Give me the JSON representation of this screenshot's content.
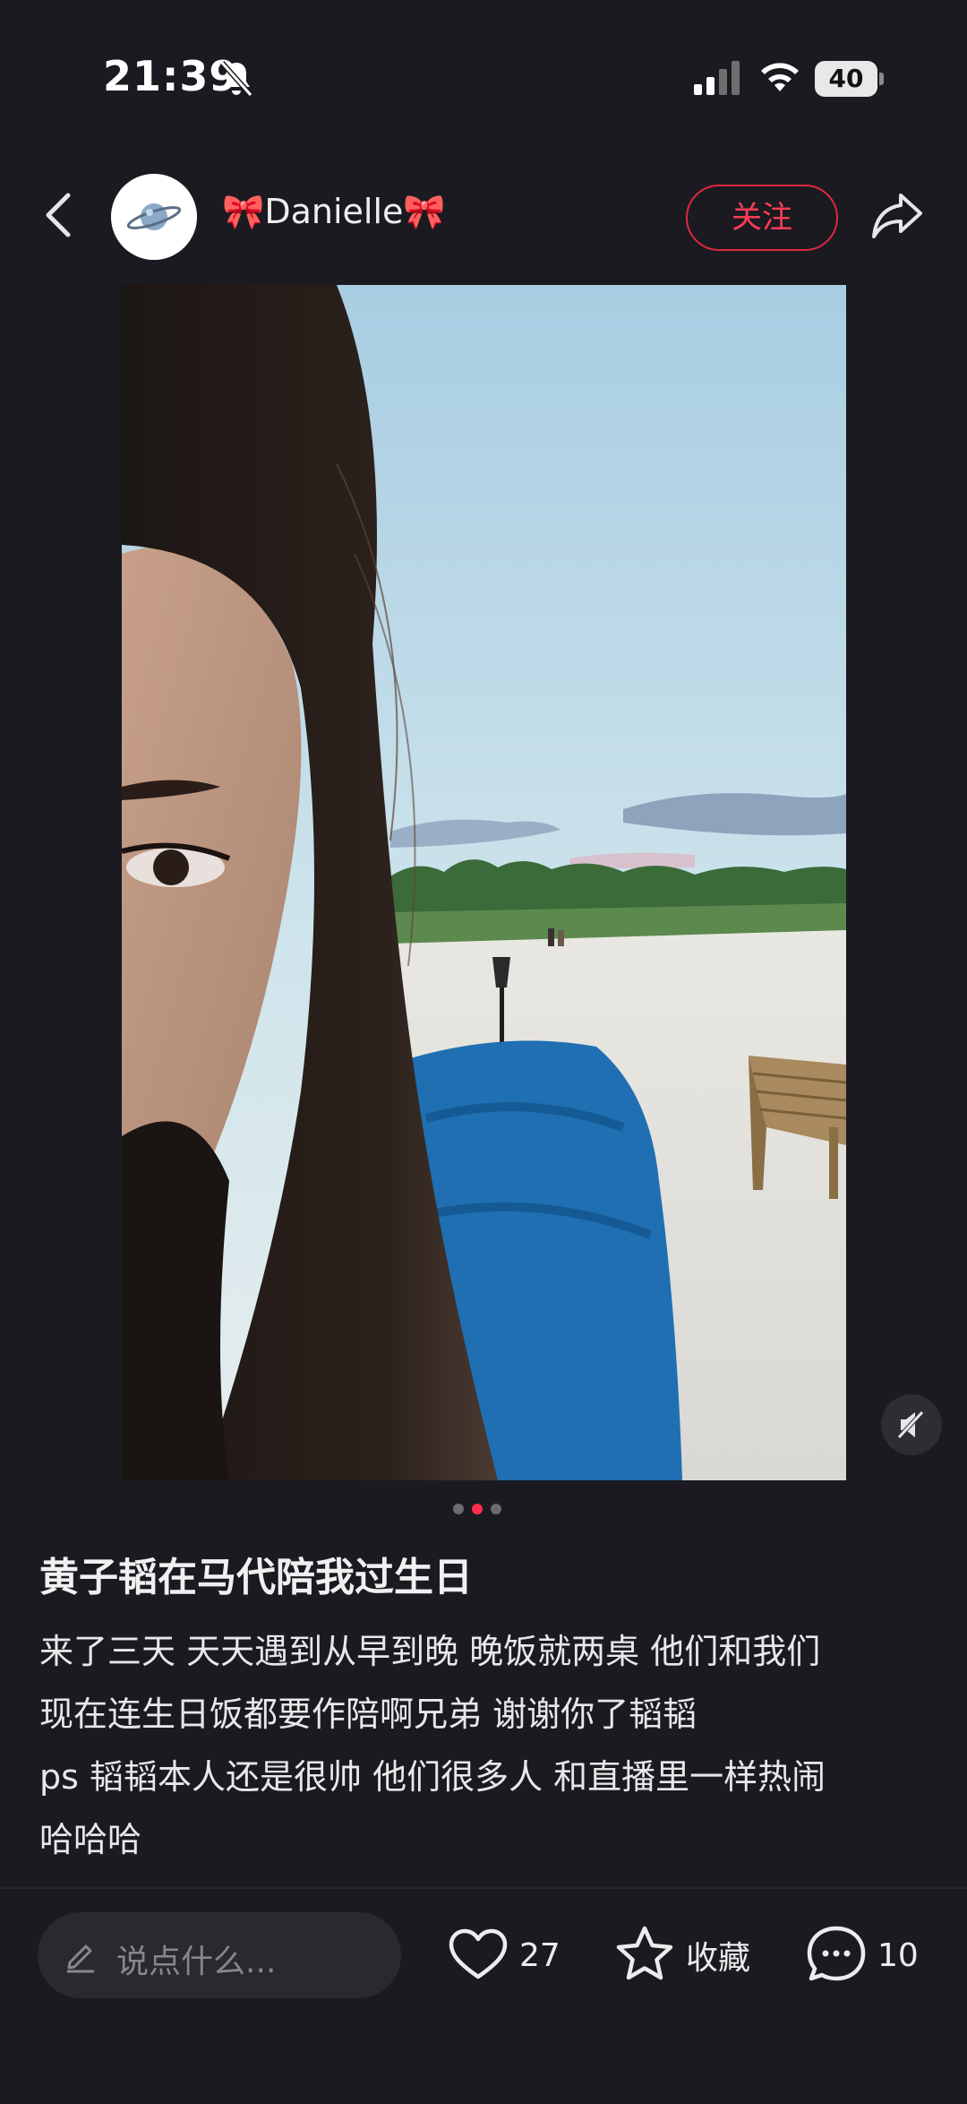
{
  "status_bar": {
    "time": "21:39",
    "battery": "40",
    "icons": [
      "bell-slash-icon",
      "signal-icon",
      "wifi-icon",
      "battery-icon"
    ]
  },
  "header": {
    "username": "🎀Danielle🎀",
    "follow_label": "关注",
    "icons": [
      "chevron-left-icon",
      "planet-avatar",
      "share-icon"
    ]
  },
  "media": {
    "page_count": 3,
    "active_page": 2,
    "icons": [
      "mute-icon"
    ]
  },
  "post": {
    "title": "黄子韬在马代陪我过生日",
    "lines": [
      "来了三天 天天遇到从早到晚  晚饭就两桌 他们和我们",
      "现在连生日饭都要作陪啊兄弟 谢谢你了韬韬",
      "ps 韬韬本人还是很帅 他们很多人 和直播里一样热闹",
      "哈哈哈"
    ]
  },
  "bottom_bar": {
    "comment_placeholder": "说点什么...",
    "likes": "27",
    "collect_label": "收藏",
    "comments": "10",
    "icons": [
      "pen-icon",
      "heart-icon",
      "star-icon",
      "comment-bubble-icon"
    ]
  },
  "colors": {
    "background": "#1b1a21",
    "accent": "#ff2e4d",
    "input_background": "#2a2930"
  }
}
